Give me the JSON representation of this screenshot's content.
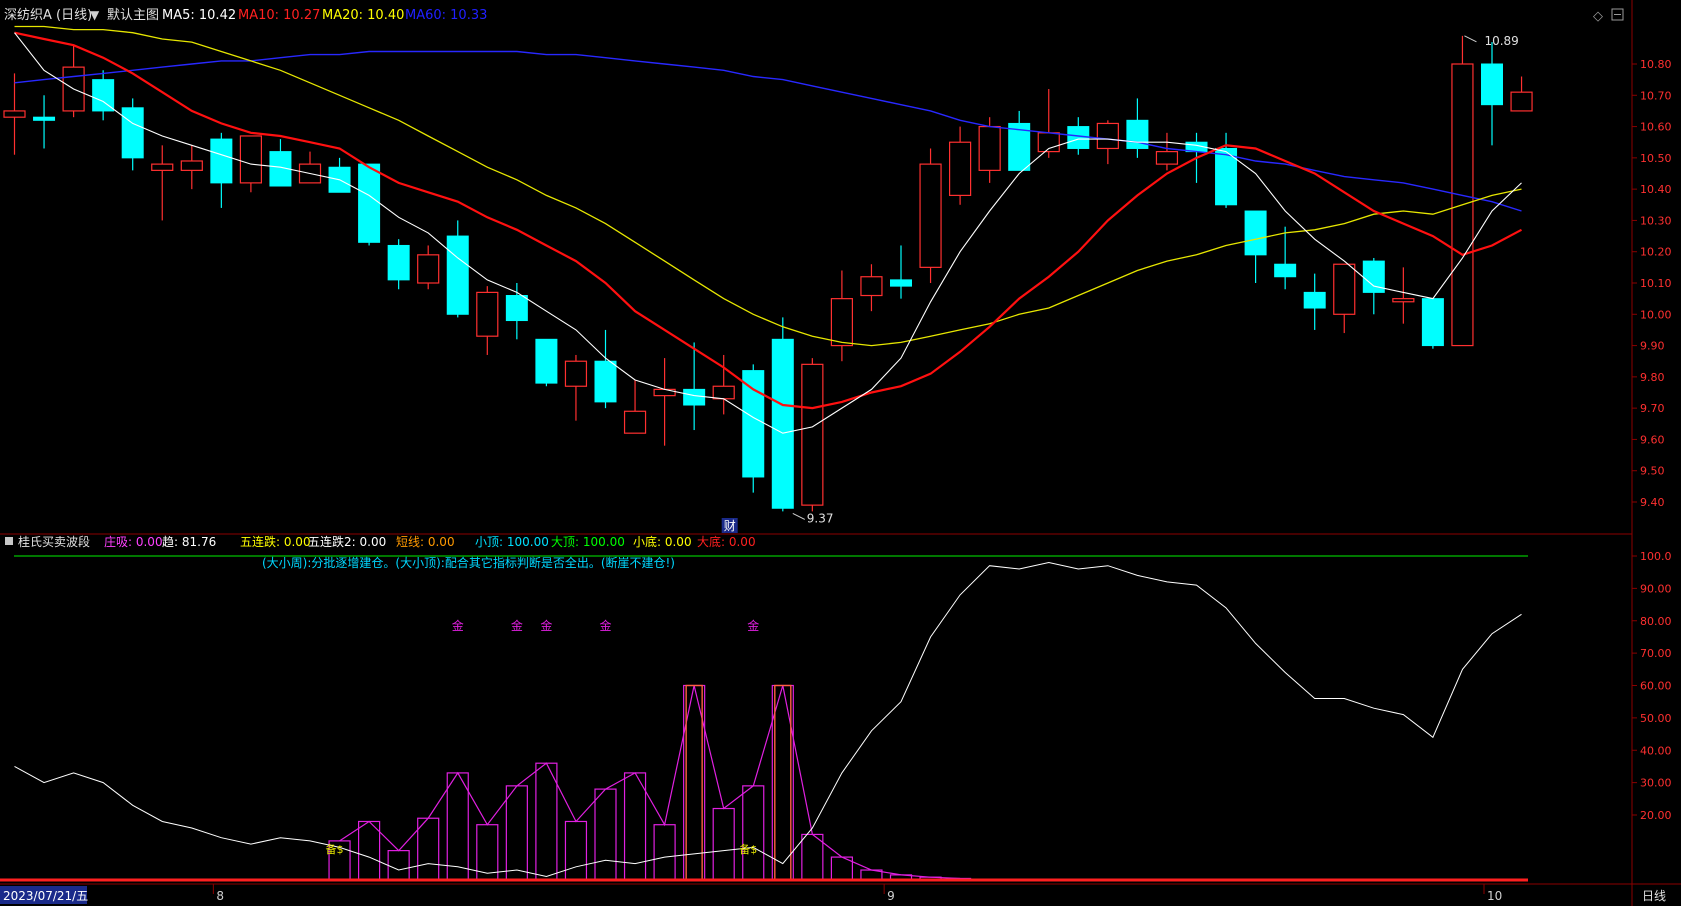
{
  "header": {
    "stock_name": "深纺织A (日线)",
    "template": "默认主图",
    "ma_items": [
      {
        "label": "MA5: 10.42",
        "color": "#ffffff"
      },
      {
        "label": "MA10: 10.27",
        "color": "#ff2020"
      },
      {
        "label": "MA20: 10.40",
        "color": "#ffff00"
      },
      {
        "label": "MA60: 10.33",
        "color": "#2020ff"
      }
    ]
  },
  "sub_header": {
    "indicator_name": "桂氏买卖波段",
    "items": [
      {
        "label": "庄吸: 0.00",
        "color": "#ff40ff"
      },
      {
        "label": "趋: 81.76",
        "color": "#ffffff"
      },
      {
        "label": "五连跌: 0.00",
        "color": "#ffff00"
      },
      {
        "label": "五连跌2: 0.00",
        "color": "#ffffff"
      },
      {
        "label": "短线: 0.00",
        "color": "#ff9900"
      },
      {
        "label": "小顶: 100.00",
        "color": "#00e0ff"
      },
      {
        "label": "大顶: 100.00",
        "color": "#00ff00"
      },
      {
        "label": "小底: 0.00",
        "color": "#ffff00"
      },
      {
        "label": "大底: 0.00",
        "color": "#ff2020"
      }
    ],
    "note": "(大小周):分批逐增建仓。(大小顶):配合其它指标判断是否全出。(断崖不建仓!)"
  },
  "markers": {
    "high_label": "10.89",
    "low_label": "9.37",
    "cai_label": "财",
    "jin_label": "金",
    "bei_label": "备$"
  },
  "footer": {
    "date_box": "2023/07/21/五",
    "month_labels": [
      "8",
      "9",
      "10"
    ],
    "period": "日线"
  },
  "colors": {
    "up": "#ff3030",
    "down": "#00ffff",
    "ma5": "#ffffff",
    "ma10": "#ff1010",
    "ma20": "#e6e600",
    "ma60": "#2828ff",
    "axis": "#8b0000",
    "trend": "#ffffff",
    "magenta": "#e020e0",
    "short_bar": "#ff6040"
  },
  "chart_data": [
    {
      "type": "candlestick",
      "price_axis_ticks": [
        "10.80",
        "10.70",
        "10.60",
        "10.50",
        "10.40",
        "10.30",
        "10.20",
        "10.10",
        "10.00",
        "9.90",
        "9.80",
        "9.70",
        "9.60",
        "9.50",
        "9.40"
      ],
      "ylim": [
        9.35,
        10.93
      ],
      "candles": [
        {
          "o": 10.63,
          "h": 10.77,
          "l": 10.51,
          "c": 10.65
        },
        {
          "o": 10.63,
          "h": 10.7,
          "l": 10.53,
          "c": 10.62
        },
        {
          "o": 10.65,
          "h": 10.86,
          "l": 10.63,
          "c": 10.79
        },
        {
          "o": 10.75,
          "h": 10.78,
          "l": 10.62,
          "c": 10.65
        },
        {
          "o": 10.66,
          "h": 10.69,
          "l": 10.46,
          "c": 10.5
        },
        {
          "o": 10.46,
          "h": 10.54,
          "l": 10.3,
          "c": 10.48
        },
        {
          "o": 10.46,
          "h": 10.54,
          "l": 10.4,
          "c": 10.49
        },
        {
          "o": 10.56,
          "h": 10.58,
          "l": 10.34,
          "c": 10.42
        },
        {
          "o": 10.42,
          "h": 10.57,
          "l": 10.39,
          "c": 10.57
        },
        {
          "o": 10.52,
          "h": 10.56,
          "l": 10.41,
          "c": 10.41
        },
        {
          "o": 10.42,
          "h": 10.52,
          "l": 10.42,
          "c": 10.48
        },
        {
          "o": 10.47,
          "h": 10.5,
          "l": 10.4,
          "c": 10.39
        },
        {
          "o": 10.48,
          "h": 10.48,
          "l": 10.22,
          "c": 10.23
        },
        {
          "o": 10.22,
          "h": 10.24,
          "l": 10.08,
          "c": 10.11
        },
        {
          "o": 10.1,
          "h": 10.22,
          "l": 10.08,
          "c": 10.19
        },
        {
          "o": 10.25,
          "h": 10.3,
          "l": 9.99,
          "c": 10.0
        },
        {
          "o": 9.93,
          "h": 10.09,
          "l": 9.87,
          "c": 10.07
        },
        {
          "o": 10.06,
          "h": 10.1,
          "l": 9.92,
          "c": 9.98
        },
        {
          "o": 9.92,
          "h": 9.92,
          "l": 9.77,
          "c": 9.78
        },
        {
          "o": 9.77,
          "h": 9.87,
          "l": 9.66,
          "c": 9.85
        },
        {
          "o": 9.85,
          "h": 9.95,
          "l": 9.7,
          "c": 9.72
        },
        {
          "o": 9.62,
          "h": 9.79,
          "l": 9.62,
          "c": 9.69
        },
        {
          "o": 9.74,
          "h": 9.86,
          "l": 9.58,
          "c": 9.76
        },
        {
          "o": 9.76,
          "h": 9.91,
          "l": 9.63,
          "c": 9.71
        },
        {
          "o": 9.73,
          "h": 9.87,
          "l": 9.68,
          "c": 9.77
        },
        {
          "o": 9.82,
          "h": 9.84,
          "l": 9.43,
          "c": 9.48
        },
        {
          "o": 9.92,
          "h": 9.99,
          "l": 9.37,
          "c": 9.38
        },
        {
          "o": 9.39,
          "h": 9.86,
          "l": 9.37,
          "c": 9.84
        },
        {
          "o": 9.9,
          "h": 10.14,
          "l": 9.85,
          "c": 10.05
        },
        {
          "o": 10.06,
          "h": 10.16,
          "l": 10.01,
          "c": 10.12
        },
        {
          "o": 10.11,
          "h": 10.22,
          "l": 10.05,
          "c": 10.09
        },
        {
          "o": 10.15,
          "h": 10.53,
          "l": 10.1,
          "c": 10.48
        },
        {
          "o": 10.38,
          "h": 10.6,
          "l": 10.35,
          "c": 10.55
        },
        {
          "o": 10.46,
          "h": 10.63,
          "l": 10.42,
          "c": 10.6
        },
        {
          "o": 10.61,
          "h": 10.65,
          "l": 10.46,
          "c": 10.46
        },
        {
          "o": 10.52,
          "h": 10.72,
          "l": 10.5,
          "c": 10.58
        },
        {
          "o": 10.6,
          "h": 10.63,
          "l": 10.51,
          "c": 10.53
        },
        {
          "o": 10.53,
          "h": 10.62,
          "l": 10.48,
          "c": 10.61
        },
        {
          "o": 10.62,
          "h": 10.69,
          "l": 10.5,
          "c": 10.53
        },
        {
          "o": 10.48,
          "h": 10.58,
          "l": 10.46,
          "c": 10.52
        },
        {
          "o": 10.55,
          "h": 10.58,
          "l": 10.42,
          "c": 10.52
        },
        {
          "o": 10.53,
          "h": 10.58,
          "l": 10.34,
          "c": 10.35
        },
        {
          "o": 10.33,
          "h": 10.33,
          "l": 10.1,
          "c": 10.19
        },
        {
          "o": 10.16,
          "h": 10.28,
          "l": 10.08,
          "c": 10.12
        },
        {
          "o": 10.07,
          "h": 10.13,
          "l": 9.95,
          "c": 10.02
        },
        {
          "o": 10.0,
          "h": 10.16,
          "l": 9.94,
          "c": 10.16
        },
        {
          "o": 10.17,
          "h": 10.18,
          "l": 10.0,
          "c": 10.07
        },
        {
          "o": 10.04,
          "h": 10.15,
          "l": 9.97,
          "c": 10.05
        },
        {
          "o": 10.05,
          "h": 10.05,
          "l": 9.89,
          "c": 9.9
        },
        {
          "o": 9.9,
          "h": 10.89,
          "l": 9.9,
          "c": 10.8
        },
        {
          "o": 10.8,
          "h": 10.87,
          "l": 10.54,
          "c": 10.67
        },
        {
          "o": 10.65,
          "h": 10.76,
          "l": 10.65,
          "c": 10.71
        }
      ],
      "ma5": [
        10.9,
        10.78,
        10.72,
        10.68,
        10.61,
        10.57,
        10.54,
        10.51,
        10.48,
        10.47,
        10.45,
        10.43,
        10.38,
        10.31,
        10.26,
        10.18,
        10.11,
        10.07,
        10.01,
        9.95,
        9.86,
        9.79,
        9.76,
        9.74,
        9.73,
        9.67,
        9.62,
        9.64,
        9.7,
        9.76,
        9.86,
        10.04,
        10.2,
        10.33,
        10.45,
        10.53,
        10.56,
        10.56,
        10.55,
        10.55,
        10.54,
        10.52,
        10.45,
        10.33,
        10.24,
        10.17,
        10.09,
        10.07,
        10.05,
        10.18,
        10.33,
        10.42
      ],
      "ma10": [
        10.9,
        10.88,
        10.86,
        10.82,
        10.77,
        10.71,
        10.65,
        10.61,
        10.58,
        10.57,
        10.55,
        10.53,
        10.47,
        10.42,
        10.39,
        10.36,
        10.31,
        10.27,
        10.22,
        10.17,
        10.1,
        10.01,
        9.95,
        9.89,
        9.83,
        9.76,
        9.71,
        9.7,
        9.72,
        9.75,
        9.77,
        9.81,
        9.88,
        9.96,
        10.05,
        10.12,
        10.2,
        10.3,
        10.38,
        10.45,
        10.5,
        10.54,
        10.53,
        10.49,
        10.45,
        10.39,
        10.33,
        10.29,
        10.25,
        10.19,
        10.22,
        10.27
      ],
      "ma20": [
        10.92,
        10.92,
        10.91,
        10.91,
        10.9,
        10.88,
        10.87,
        10.84,
        10.81,
        10.78,
        10.74,
        10.7,
        10.66,
        10.62,
        10.57,
        10.52,
        10.47,
        10.43,
        10.38,
        10.34,
        10.29,
        10.23,
        10.17,
        10.11,
        10.05,
        10.0,
        9.96,
        9.93,
        9.91,
        9.9,
        9.91,
        9.93,
        9.95,
        9.97,
        10.0,
        10.02,
        10.06,
        10.1,
        10.14,
        10.17,
        10.19,
        10.22,
        10.24,
        10.26,
        10.27,
        10.29,
        10.32,
        10.33,
        10.32,
        10.35,
        10.38,
        10.4
      ],
      "ma60": [
        10.74,
        10.75,
        10.76,
        10.77,
        10.78,
        10.79,
        10.8,
        10.81,
        10.81,
        10.82,
        10.83,
        10.83,
        10.84,
        10.84,
        10.84,
        10.84,
        10.84,
        10.84,
        10.83,
        10.83,
        10.82,
        10.81,
        10.8,
        10.79,
        10.78,
        10.76,
        10.75,
        10.73,
        10.71,
        10.69,
        10.67,
        10.65,
        10.62,
        10.6,
        10.59,
        10.58,
        10.57,
        10.56,
        10.55,
        10.53,
        10.52,
        10.51,
        10.49,
        10.48,
        10.46,
        10.44,
        10.43,
        10.42,
        10.4,
        10.38,
        10.36,
        10.33
      ]
    },
    {
      "type": "indicator",
      "name": "桂氏买卖波段",
      "axis_ticks": [
        "100.0",
        "90.00",
        "80.00",
        "70.00",
        "60.00",
        "50.00",
        "40.00",
        "30.00",
        "20.00"
      ],
      "ylim": [
        0,
        103
      ],
      "trend": [
        35,
        30,
        33,
        30,
        23,
        18,
        16,
        13,
        11,
        13,
        12,
        10,
        7,
        3,
        5,
        4,
        2,
        3,
        1,
        4,
        6,
        5,
        7,
        8,
        9,
        10,
        5,
        16,
        33,
        46,
        55,
        75,
        88,
        97,
        96,
        98,
        96,
        97,
        94,
        92,
        91,
        84,
        73,
        64,
        56,
        56,
        53,
        51,
        44,
        65,
        76,
        82
      ],
      "bars": [
        {
          "i": 11,
          "v": 12
        },
        {
          "i": 12,
          "v": 18
        },
        {
          "i": 13,
          "v": 9
        },
        {
          "i": 14,
          "v": 19
        },
        {
          "i": 15,
          "v": 33
        },
        {
          "i": 16,
          "v": 17
        },
        {
          "i": 17,
          "v": 29
        },
        {
          "i": 18,
          "v": 36
        },
        {
          "i": 19,
          "v": 18
        },
        {
          "i": 20,
          "v": 28
        },
        {
          "i": 21,
          "v": 33
        },
        {
          "i": 22,
          "v": 17
        },
        {
          "i": 23,
          "v": 60
        },
        {
          "i": 24,
          "v": 22
        },
        {
          "i": 25,
          "v": 29
        },
        {
          "i": 26,
          "v": 60
        },
        {
          "i": 27,
          "v": 14
        },
        {
          "i": 28,
          "v": 7
        },
        {
          "i": 29,
          "v": 3
        },
        {
          "i": 30,
          "v": 1.5
        },
        {
          "i": 31,
          "v": 0.8
        },
        {
          "i": 32,
          "v": 0.4
        }
      ],
      "short_line_bars": [
        23,
        26
      ],
      "jin_positions": [
        15,
        17,
        18,
        20,
        25
      ],
      "bei_positions": [
        11,
        25
      ],
      "top_line": 100
    }
  ]
}
